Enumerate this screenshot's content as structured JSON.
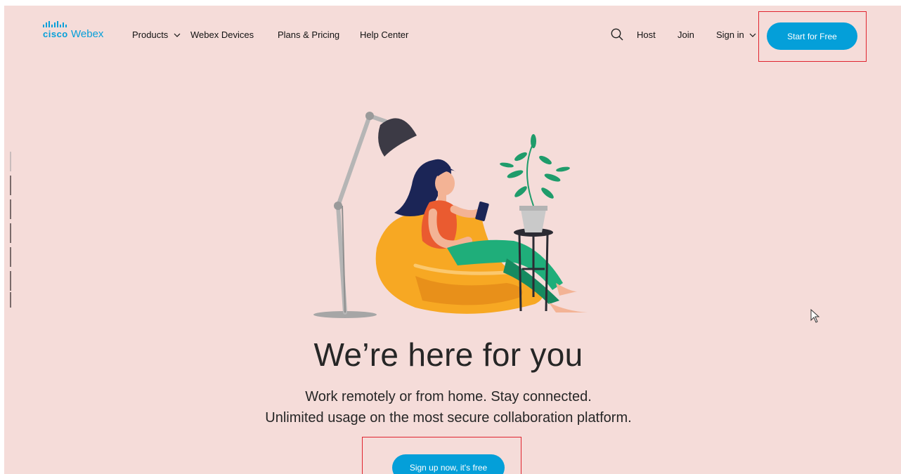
{
  "header": {
    "logo": {
      "brand": "cisco",
      "product": "Webex"
    },
    "nav": [
      {
        "label": "Products",
        "has_dropdown": true
      },
      {
        "label": "Webex Devices",
        "has_dropdown": false
      },
      {
        "label": "Plans & Pricing",
        "has_dropdown": false
      },
      {
        "label": "Help Center",
        "has_dropdown": false
      }
    ],
    "right": {
      "search_icon": "search-icon",
      "host": "Host",
      "join": "Join",
      "signin": "Sign in",
      "cta": "Start for Free"
    }
  },
  "hero": {
    "title": "We’re here for you",
    "subtitle_line1": "Work remotely or from home. Stay connected.",
    "subtitle_line2": "Unlimited usage on the most secure collaboration platform.",
    "cta": "Sign up now, it's free"
  },
  "colors": {
    "background": "#f5dcd9",
    "accent": "#049fd9",
    "highlight_box": "#e0242f",
    "text": "#262626"
  }
}
